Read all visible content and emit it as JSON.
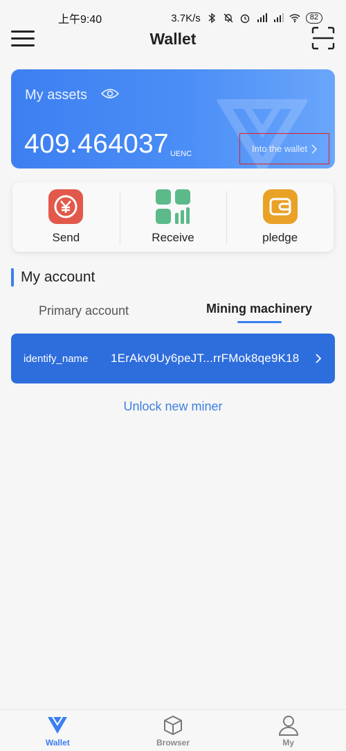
{
  "status_bar": {
    "time": "上午9:40",
    "speed": "3.7K/s",
    "battery": "82"
  },
  "header": {
    "title": "Wallet",
    "menu_icon": "hamburger-icon",
    "scan_icon": "scan-icon"
  },
  "assets": {
    "label": "My assets",
    "value": "409.464037",
    "unit": "UENC",
    "into_wallet": "Into the wallet"
  },
  "actions": [
    {
      "label": "Send",
      "icon": "send-icon",
      "color": "#e2584a"
    },
    {
      "label": "Receive",
      "icon": "receive-icon",
      "color": "#5bb98a"
    },
    {
      "label": "pledge",
      "icon": "pledge-icon",
      "color": "#e9a127"
    }
  ],
  "account": {
    "section_title": "My account",
    "tabs": [
      "Primary account",
      "Mining machinery"
    ],
    "active_tab": "Mining machinery",
    "rows": [
      {
        "name": "identify_name",
        "address": "1ErAkv9Uy6peJT...rrFMok8qe9K18"
      }
    ],
    "unlock_link": "Unlock new miner"
  },
  "bottom_nav": [
    {
      "label": "Wallet",
      "icon": "wallet-icon",
      "active": true
    },
    {
      "label": "Browser",
      "icon": "cube-icon",
      "active": false
    },
    {
      "label": "My",
      "icon": "person-icon",
      "active": false
    }
  ],
  "colors": {
    "accent": "#3b7ff0",
    "card_blue": "#4b8ef6",
    "row_blue": "#2e6ddc",
    "highlight_box": "#e02020"
  }
}
